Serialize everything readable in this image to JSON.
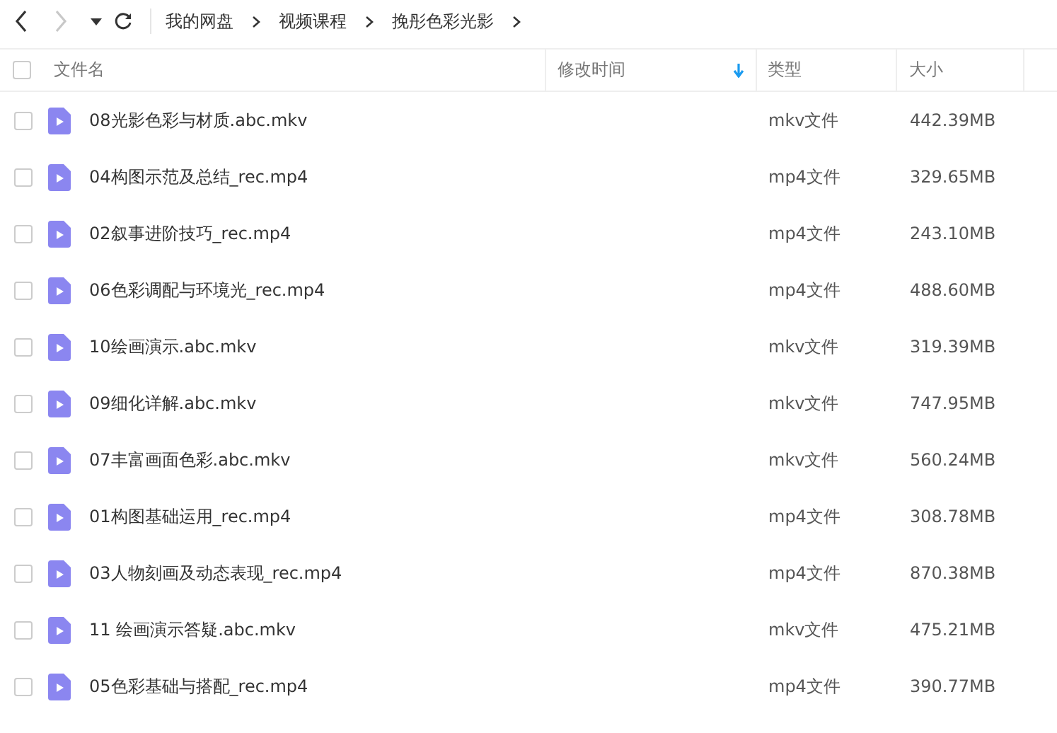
{
  "toolbar": {
    "back": {
      "disabled": false
    },
    "forward": {
      "disabled": true
    },
    "breadcrumbs": [
      "我的网盘",
      "视频课程",
      "挽彤色彩光影"
    ]
  },
  "table": {
    "select_all": {
      "checked": false
    },
    "columns": [
      {
        "label": "文件名",
        "sorted": false
      },
      {
        "label": "修改时间",
        "sorted": true
      },
      {
        "label": "类型",
        "sorted": false
      },
      {
        "label": "大小",
        "sorted": false
      }
    ],
    "rows": [
      {
        "checked": false,
        "name": "08光影色彩与材质.abc.mkv",
        "type": "mkv文件",
        "size": "442.39MB"
      },
      {
        "checked": false,
        "name": "04构图示范及总结_rec.mp4",
        "type": "mp4文件",
        "size": "329.65MB"
      },
      {
        "checked": false,
        "name": "02叙事进阶技巧_rec.mp4",
        "type": "mp4文件",
        "size": "243.10MB"
      },
      {
        "checked": false,
        "name": "06色彩调配与环境光_rec.mp4",
        "type": "mp4文件",
        "size": "488.60MB"
      },
      {
        "checked": false,
        "name": "10绘画演示.abc.mkv",
        "type": "mkv文件",
        "size": "319.39MB"
      },
      {
        "checked": false,
        "name": "09细化详解.abc.mkv",
        "type": "mkv文件",
        "size": "747.95MB"
      },
      {
        "checked": false,
        "name": "07丰富画面色彩.abc.mkv",
        "type": "mkv文件",
        "size": "560.24MB"
      },
      {
        "checked": false,
        "name": "01构图基础运用_rec.mp4",
        "type": "mp4文件",
        "size": "308.78MB"
      },
      {
        "checked": false,
        "name": "03人物刻画及动态表现_rec.mp4",
        "type": "mp4文件",
        "size": "870.38MB"
      },
      {
        "checked": false,
        "name": "11 绘画演示答疑.abc.mkv",
        "type": "mkv文件",
        "size": "475.21MB"
      },
      {
        "checked": false,
        "name": "05色彩基础与搭配_rec.mp4",
        "type": "mp4文件",
        "size": "390.77MB"
      }
    ]
  }
}
